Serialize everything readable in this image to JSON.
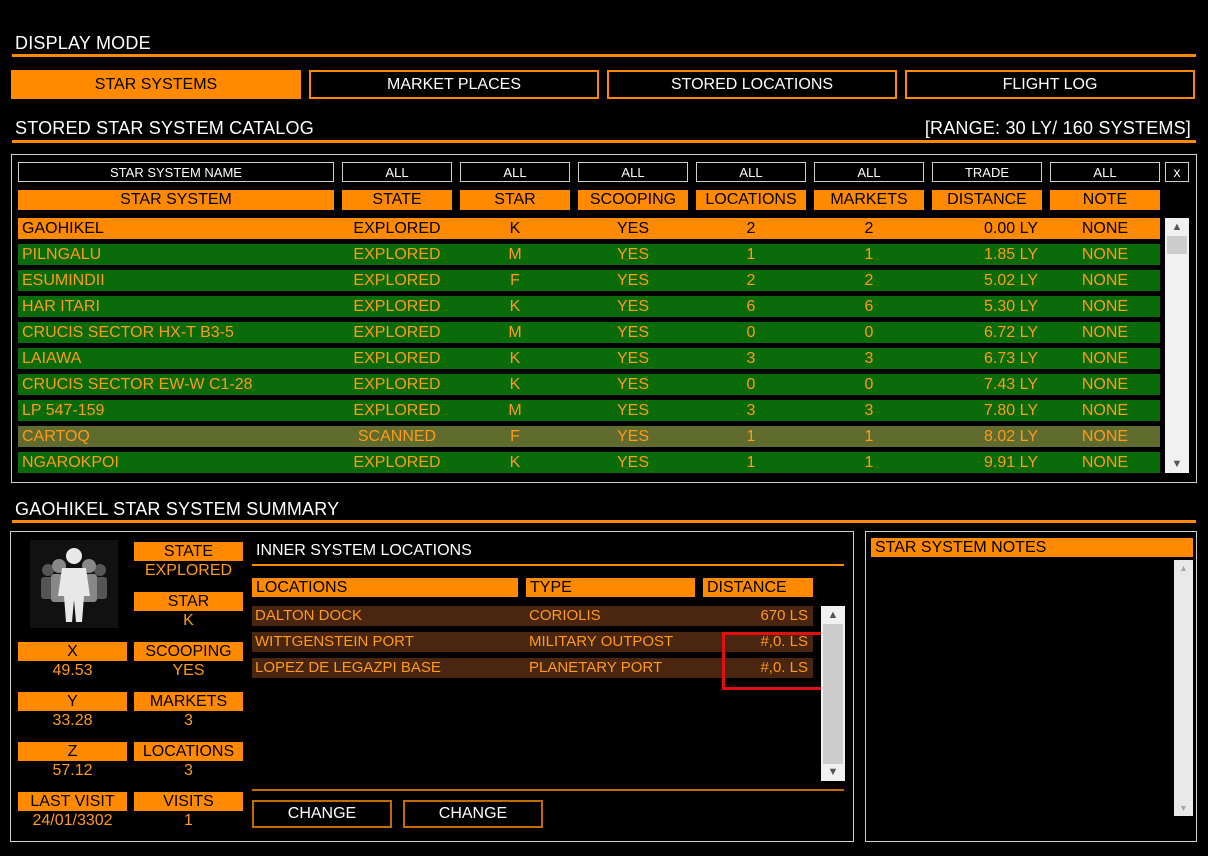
{
  "display_mode": {
    "title": "DISPLAY MODE",
    "buttons": [
      "STAR SYSTEMS",
      "MARKET PLACES",
      "STORED LOCATIONS",
      "FLIGHT LOG"
    ],
    "active": 0
  },
  "catalog": {
    "title": "STORED STAR SYSTEM CATALOG",
    "range": "[RANGE: 30 LY/ 160 SYSTEMS]",
    "filters": [
      "STAR SYSTEM NAME",
      "ALL",
      "ALL",
      "ALL",
      "ALL",
      "ALL",
      "TRADE",
      "ALL"
    ],
    "clear_label": "x",
    "columns": [
      "STAR SYSTEM",
      "STATE",
      "STAR",
      "SCOOPING",
      "LOCATIONS",
      "MARKETS",
      "DISTANCE",
      "NOTE"
    ],
    "rows": [
      {
        "name": "GAOHIKEL",
        "state": "EXPLORED",
        "star": "K",
        "scooping": "YES",
        "locations": "2",
        "markets": "2",
        "distance": "0.00 LY",
        "note": "NONE",
        "kind": "sel"
      },
      {
        "name": "PILNGALU",
        "state": "EXPLORED",
        "star": "M",
        "scooping": "YES",
        "locations": "1",
        "markets": "1",
        "distance": "1.85 LY",
        "note": "NONE",
        "kind": "expl"
      },
      {
        "name": "ESUMINDII",
        "state": "EXPLORED",
        "star": "F",
        "scooping": "YES",
        "locations": "2",
        "markets": "2",
        "distance": "5.02 LY",
        "note": "NONE",
        "kind": "expl"
      },
      {
        "name": "HAR ITARI",
        "state": "EXPLORED",
        "star": "K",
        "scooping": "YES",
        "locations": "6",
        "markets": "6",
        "distance": "5.30 LY",
        "note": "NONE",
        "kind": "expl"
      },
      {
        "name": "CRUCIS SECTOR HX-T B3-5",
        "state": "EXPLORED",
        "star": "M",
        "scooping": "YES",
        "locations": "0",
        "markets": "0",
        "distance": "6.72 LY",
        "note": "NONE",
        "kind": "expl"
      },
      {
        "name": "LAIAWA",
        "state": "EXPLORED",
        "star": "K",
        "scooping": "YES",
        "locations": "3",
        "markets": "3",
        "distance": "6.73 LY",
        "note": "NONE",
        "kind": "expl"
      },
      {
        "name": "CRUCIS SECTOR EW-W C1-28",
        "state": "EXPLORED",
        "star": "K",
        "scooping": "YES",
        "locations": "0",
        "markets": "0",
        "distance": "7.43 LY",
        "note": "NONE",
        "kind": "expl"
      },
      {
        "name": "LP 547-159",
        "state": "EXPLORED",
        "star": "M",
        "scooping": "YES",
        "locations": "3",
        "markets": "3",
        "distance": "7.80 LY",
        "note": "NONE",
        "kind": "expl"
      },
      {
        "name": "CARTOQ",
        "state": "SCANNED",
        "star": "F",
        "scooping": "YES",
        "locations": "1",
        "markets": "1",
        "distance": "8.02 LY",
        "note": "NONE",
        "kind": "scan"
      },
      {
        "name": "NGAROKPOI",
        "state": "EXPLORED",
        "star": "K",
        "scooping": "YES",
        "locations": "1",
        "markets": "1",
        "distance": "9.91 LY",
        "note": "NONE",
        "kind": "expl"
      }
    ]
  },
  "summary": {
    "title": "GAOHIKEL STAR SYSTEM SUMMARY",
    "state_label": "STATE",
    "state": "EXPLORED",
    "star_label": "STAR",
    "star": "K",
    "x_label": "X",
    "x": "49.53",
    "scooping_label": "SCOOPING",
    "scooping": "YES",
    "y_label": "Y",
    "y": "33.28",
    "markets_label": "MARKETS",
    "markets": "3",
    "z_label": "Z",
    "z": "57.12",
    "locations_label": "LOCATIONS",
    "locations": "3",
    "last_visit_label": "LAST VISIT",
    "last_visit": "24/01/3302",
    "visits_label": "VISITS",
    "visits": "1"
  },
  "inner": {
    "title": "INNER SYSTEM LOCATIONS",
    "columns": [
      "LOCATIONS",
      "TYPE",
      "DISTANCE"
    ],
    "rows": [
      {
        "name": "DALTON DOCK",
        "type": "CORIOLIS",
        "distance": "670 LS"
      },
      {
        "name": "WITTGENSTEIN PORT",
        "type": "MILITARY OUTPOST",
        "distance": "#,0. LS"
      },
      {
        "name": "LOPEZ DE LEGAZPI BASE",
        "type": "PLANETARY PORT",
        "distance": "#,0. LS"
      }
    ],
    "change_buttons": [
      "CHANGE",
      "CHANGE"
    ]
  },
  "notes": {
    "title": "STAR SYSTEM NOTES"
  },
  "colors": {
    "accent": "#ff8a00",
    "text_orange": "#ff9a1a",
    "row_explored": "#0a6b0a",
    "row_scanned": "#5f6c2e",
    "location_row": "#4a2510",
    "highlight": "#e01010"
  }
}
